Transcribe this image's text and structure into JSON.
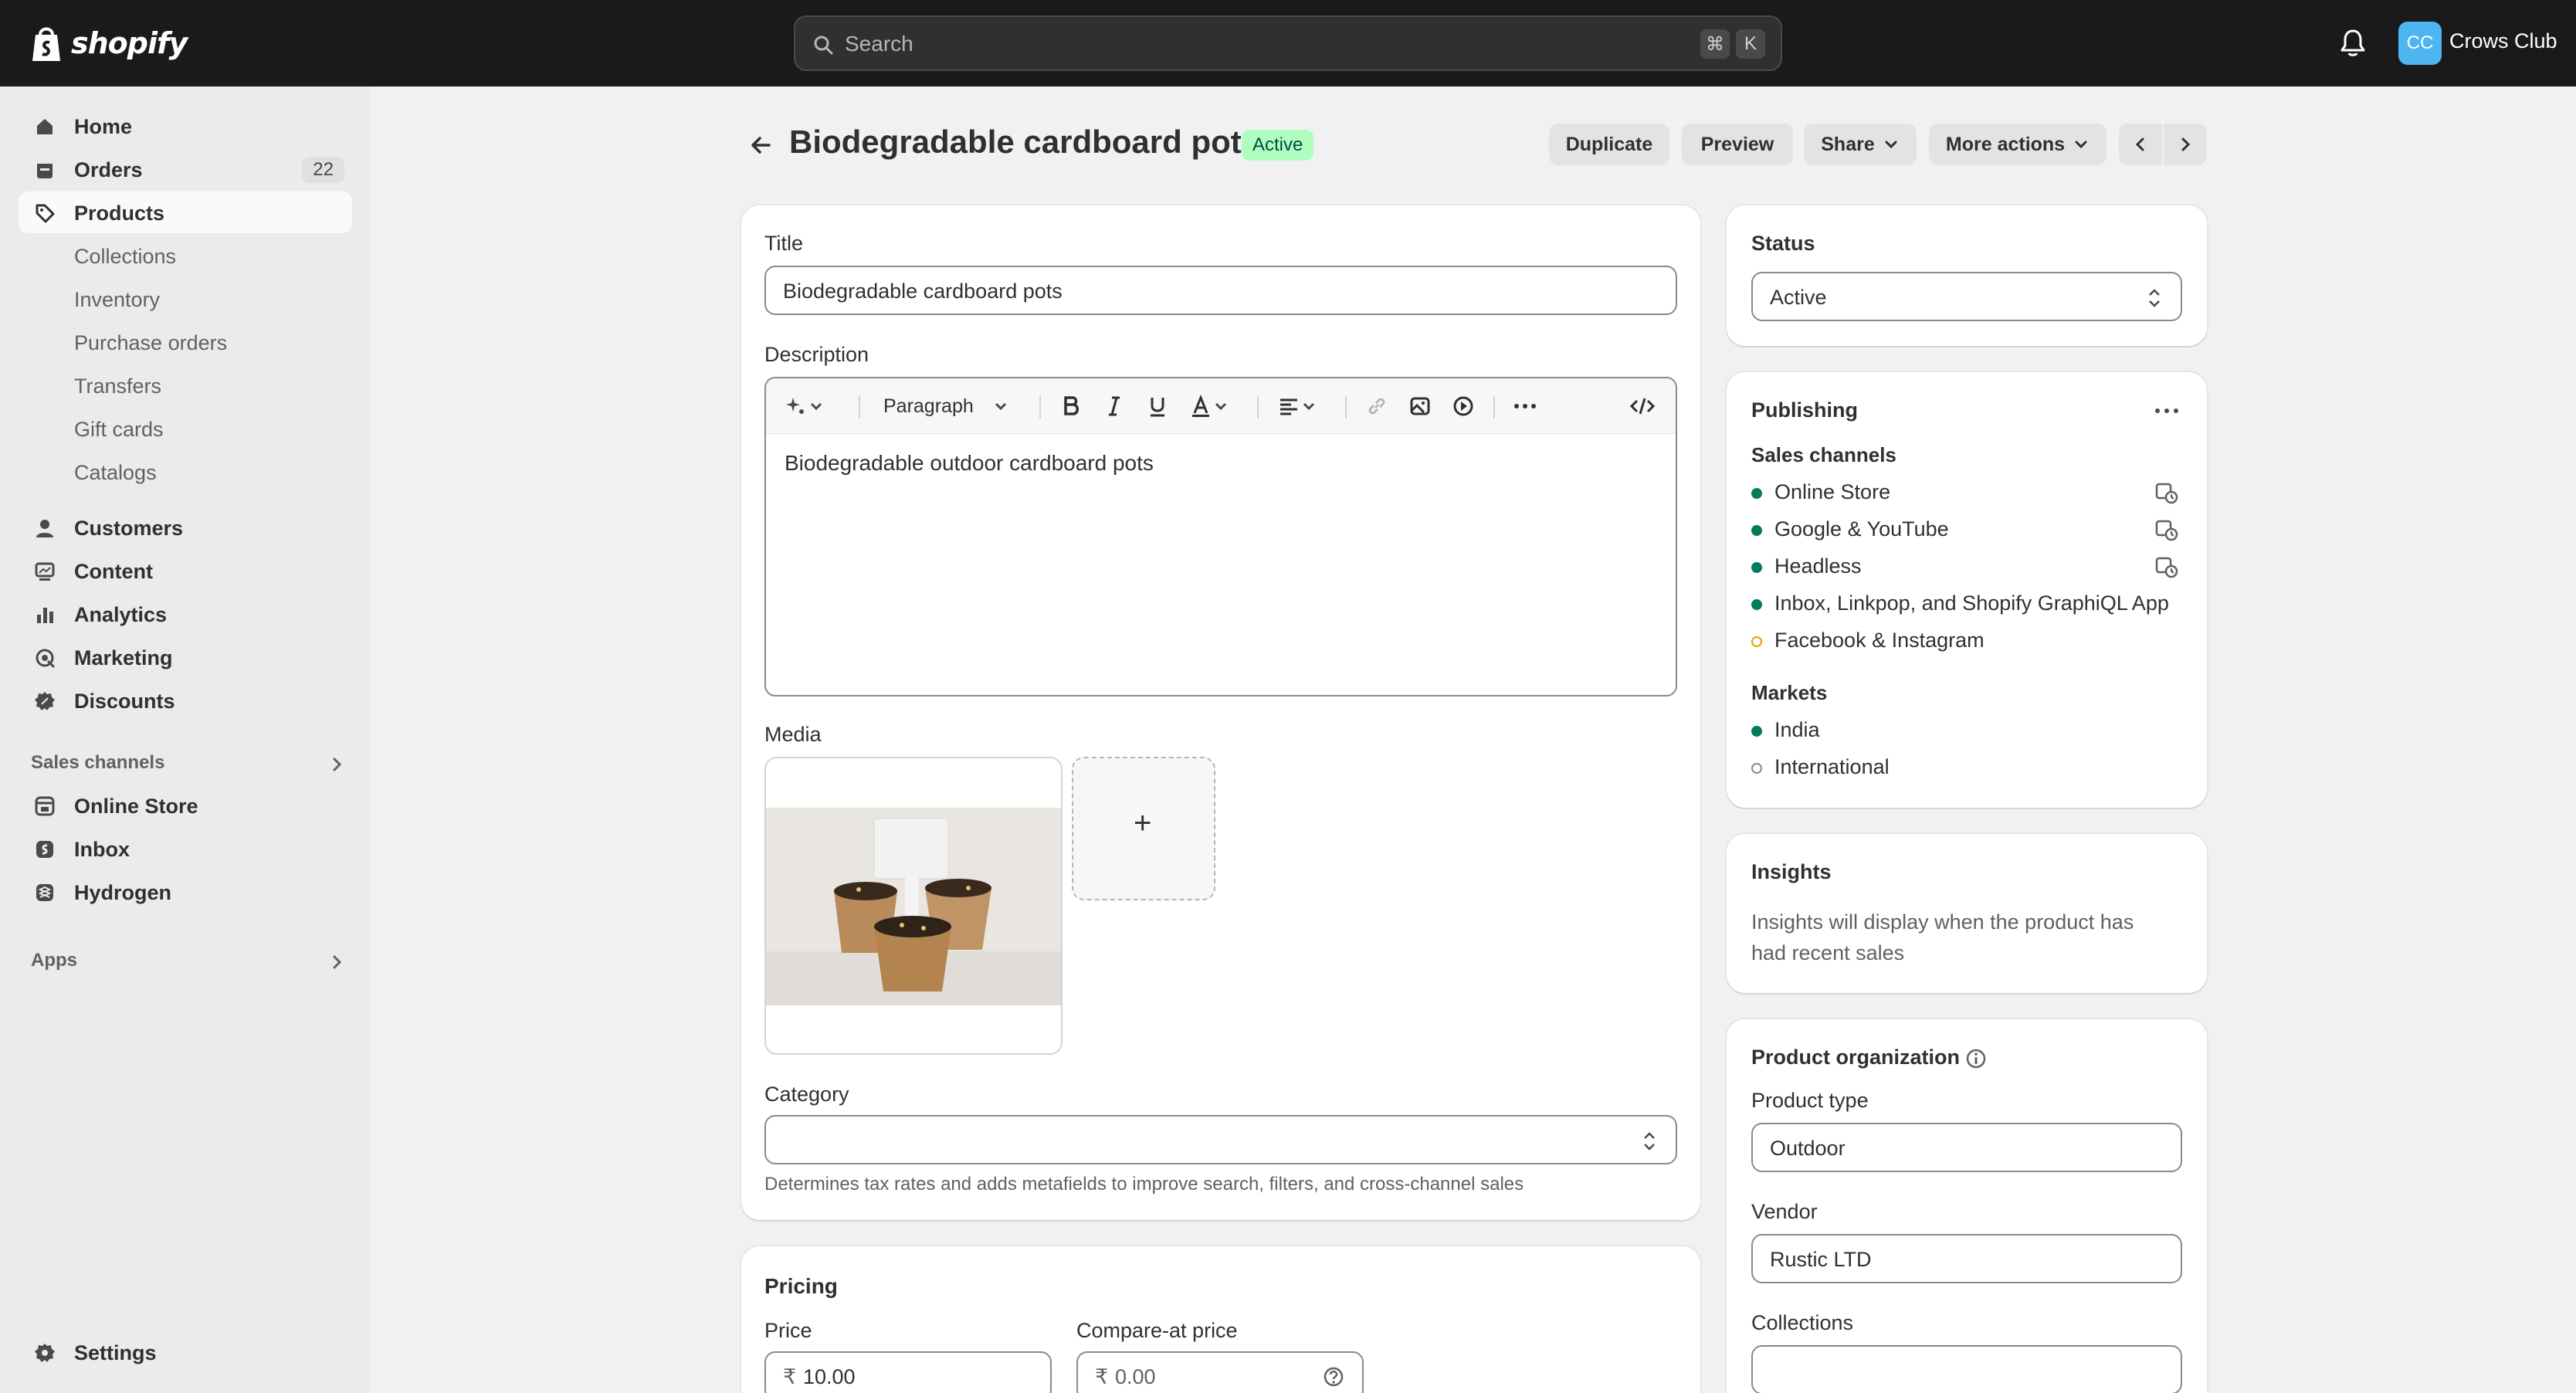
{
  "topbar": {
    "brand": "shopify",
    "search_placeholder": "Search",
    "shortcut_keys": [
      "⌘",
      "K"
    ],
    "avatar_initials": "CC",
    "store_name": "Crows Club"
  },
  "sidebar": {
    "main_items": [
      {
        "label": "Home",
        "icon": "home-icon"
      },
      {
        "label": "Orders",
        "icon": "orders-icon",
        "badge": "22"
      },
      {
        "label": "Products",
        "icon": "tag-icon",
        "active": true
      }
    ],
    "product_subitems": [
      "Collections",
      "Inventory",
      "Purchase orders",
      "Transfers",
      "Gift cards",
      "Catalogs"
    ],
    "more_items": [
      {
        "label": "Customers",
        "icon": "person-icon"
      },
      {
        "label": "Content",
        "icon": "content-icon"
      },
      {
        "label": "Analytics",
        "icon": "analytics-icon"
      },
      {
        "label": "Marketing",
        "icon": "marketing-icon"
      },
      {
        "label": "Discounts",
        "icon": "discount-icon"
      }
    ],
    "sales_channels_heading": "Sales channels",
    "sales_channels": [
      {
        "label": "Online Store",
        "icon": "store-icon"
      },
      {
        "label": "Inbox",
        "icon": "inbox-icon"
      },
      {
        "label": "Hydrogen",
        "icon": "hydrogen-icon"
      }
    ],
    "apps_heading": "Apps",
    "settings_label": "Settings"
  },
  "header": {
    "title": "Biodegradable cardboard pots",
    "status_badge": "Active",
    "buttons": {
      "duplicate": "Duplicate",
      "preview": "Preview",
      "share": "Share",
      "more_actions": "More actions"
    }
  },
  "product": {
    "title_label": "Title",
    "title_value": "Biodegradable cardboard pots",
    "description_label": "Description",
    "toolbar_paragraph": "Paragraph",
    "description_text": "Biodegradable outdoor cardboard pots",
    "media_label": "Media",
    "media_add_symbol": "+",
    "category_label": "Category",
    "category_help": "Determines tax rates and adds metafields to improve search, filters, and cross-channel sales"
  },
  "pricing": {
    "heading": "Pricing",
    "price_label": "Price",
    "price_currency": "₹",
    "price_value": "10.00",
    "compare_label": "Compare-at price",
    "compare_currency": "₹",
    "compare_placeholder": "0.00"
  },
  "status_card": {
    "heading": "Status",
    "value": "Active"
  },
  "publishing": {
    "heading": "Publishing",
    "sales_channels_label": "Sales channels",
    "channels": [
      {
        "name": "Online Store",
        "state": "active",
        "scheduled_icon": true
      },
      {
        "name": "Google & YouTube",
        "state": "active",
        "scheduled_icon": true
      },
      {
        "name": "Headless",
        "state": "active",
        "scheduled_icon": true
      },
      {
        "name": "Inbox, Linkpop, and Shopify GraphiQL App",
        "state": "active",
        "scheduled_icon": false
      },
      {
        "name": "Facebook & Instagram",
        "state": "warning",
        "scheduled_icon": false
      }
    ],
    "markets_label": "Markets",
    "markets": [
      {
        "name": "India",
        "state": "active"
      },
      {
        "name": "International",
        "state": "inactive"
      }
    ]
  },
  "insights": {
    "heading": "Insights",
    "body": "Insights will display when the product has had recent sales"
  },
  "organization": {
    "heading": "Product organization",
    "product_type_label": "Product type",
    "product_type_value": "Outdoor",
    "vendor_label": "Vendor",
    "vendor_value": "Rustic LTD",
    "collections_label": "Collections"
  },
  "colors": {
    "active_dot": "#047b5d",
    "warning_dot": "#e5a100",
    "badge_bg": "#affebf",
    "badge_text": "#014b40"
  }
}
